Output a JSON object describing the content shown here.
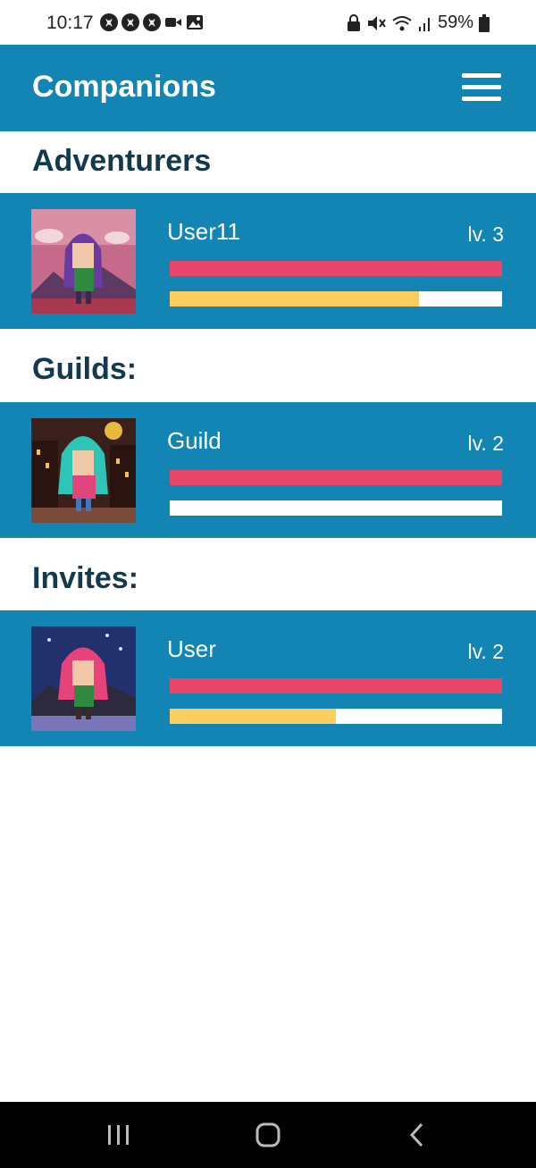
{
  "status_bar": {
    "time": "10:17",
    "battery": "59%",
    "icons_left": [
      "app-notification-icon",
      "app-notification-icon",
      "app-notification-icon",
      "video-icon",
      "image-icon"
    ],
    "icons_right": [
      "lock-icon",
      "mute-icon",
      "wifi-icon",
      "signal-icon",
      "battery-icon"
    ]
  },
  "header": {
    "title": "Companions",
    "menu_icon": "hamburger-menu-icon",
    "background": "#1285b5"
  },
  "sections": {
    "adventurers": {
      "title": "Adventurers",
      "item": {
        "name": "User11",
        "level": "lv. 3",
        "hp_fraction": 1.0,
        "xp_fraction": 0.75
      }
    },
    "guilds": {
      "title": "Guilds:",
      "item": {
        "name": "Guild",
        "level": "lv. 2",
        "hp_fraction": 1.0,
        "xp_fraction": 0.0
      }
    },
    "invites": {
      "title": "Invites:",
      "item": {
        "name": "User",
        "level": "lv. 2",
        "hp_fraction": 1.0,
        "xp_fraction": 0.5
      }
    }
  },
  "colors": {
    "card": "#1285b5",
    "heading": "#12394d",
    "hp_bar": "#e8476a",
    "xp_bar": "#fbcc5e"
  },
  "nav_bar": {
    "items": [
      "recent-apps-icon",
      "home-icon",
      "back-icon"
    ]
  }
}
